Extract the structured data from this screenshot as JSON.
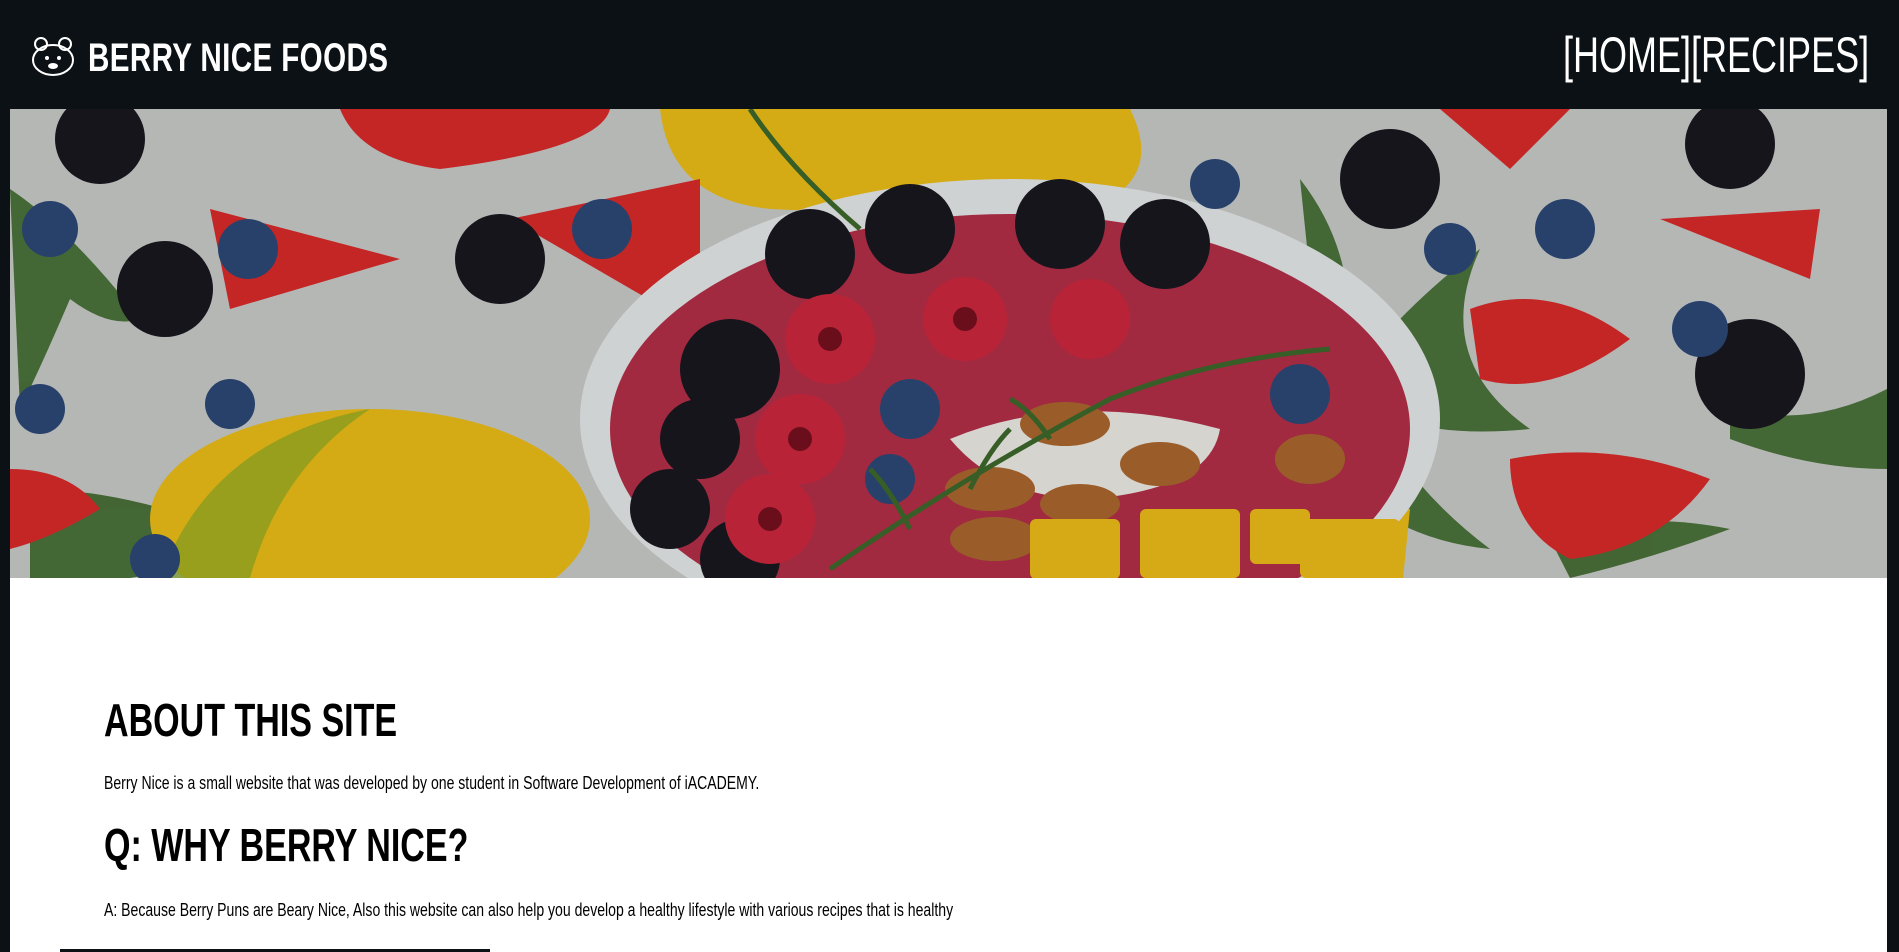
{
  "header": {
    "brand_name": "BERRY NICE FOODS",
    "logo_icon": "bear-icon"
  },
  "nav": {
    "items": [
      {
        "label": "[HOME]"
      },
      {
        "label": "[RECIPES]"
      }
    ]
  },
  "hero": {
    "image": "berry-smoothie-bowl"
  },
  "main": {
    "about_heading": "ABOUT THIS SITE",
    "about_text": "Berry Nice is a small website that was developed by one student in Software Development of iACADEMY.",
    "why_heading": "Q: WHY BERRY NICE?",
    "why_text": "A: Because Berry Puns are Beary Nice, Also this website can also help you develop a healthy lifestyle with various recipes that is healthy"
  },
  "colors": {
    "header_bg": "#0b1115",
    "content_bg": "#ffffff",
    "text": "#000000",
    "nav_text": "#ffffff"
  }
}
